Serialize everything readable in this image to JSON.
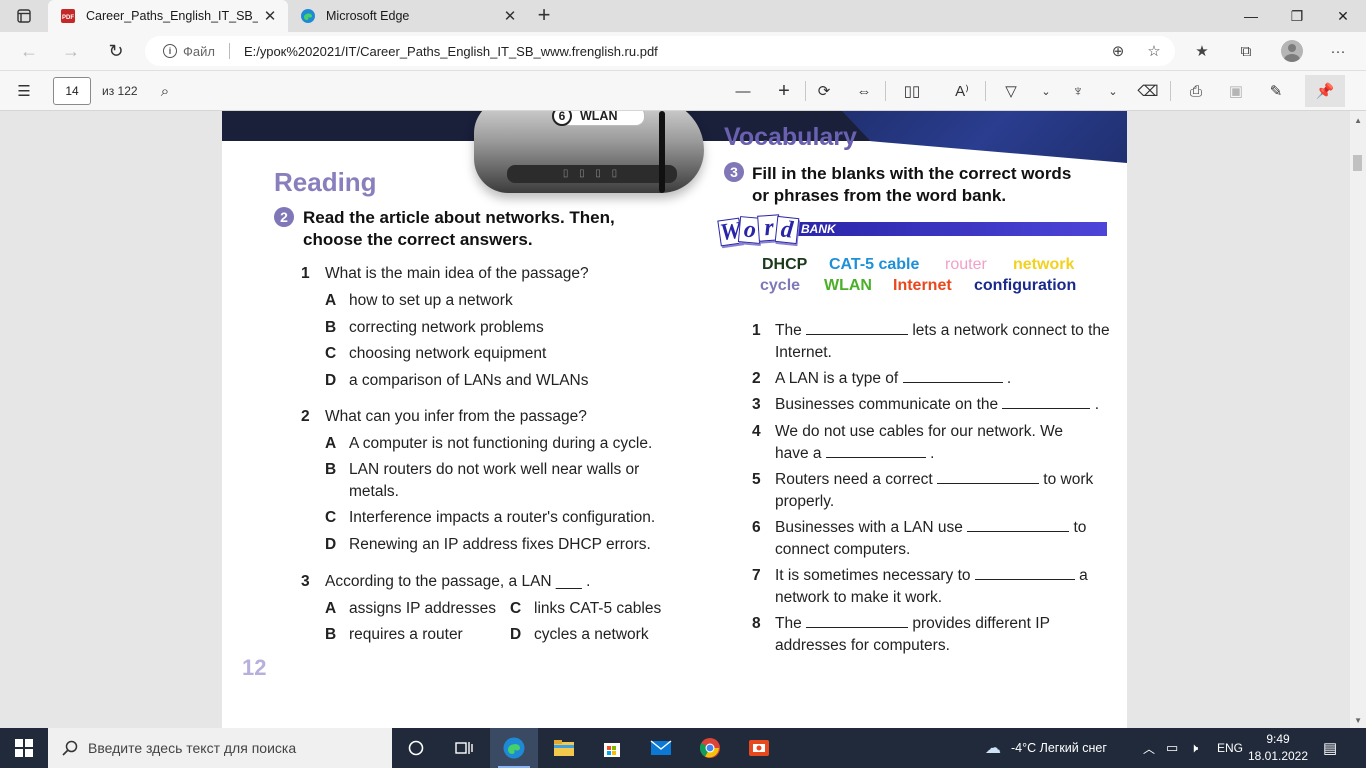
{
  "browser": {
    "tabs": [
      {
        "title": "Career_Paths_English_IT_SB_www.frenglish.ru.pdf",
        "active": true
      },
      {
        "title": "Microsoft Edge",
        "active": false
      }
    ],
    "address": {
      "scheme_label": "Файл",
      "url": "E:/урок%202021/IT/Career_Paths_English_IT_SB_www.frenglish.ru.pdf"
    }
  },
  "pdf_toolbar": {
    "page_input": "14",
    "page_count": "из 122"
  },
  "page": {
    "image_badge": {
      "number": "6",
      "label": "WLAN"
    },
    "reading": {
      "heading": "Reading",
      "exercise_number": "2",
      "instruction_line1": "Read the article about networks. Then,",
      "instruction_line2": "choose the correct answers.",
      "questions": [
        {
          "number": "1",
          "text": "What is the main idea of the passage?",
          "options": [
            {
              "letter": "A",
              "text": "how to set up a network"
            },
            {
              "letter": "B",
              "text": "correcting network problems"
            },
            {
              "letter": "C",
              "text": "choosing network equipment"
            },
            {
              "letter": "D",
              "text": "a comparison of LANs and WLANs"
            }
          ]
        },
        {
          "number": "2",
          "text": "What can you infer from the passage?",
          "options": [
            {
              "letter": "A",
              "text": "A computer is not functioning during a cycle."
            },
            {
              "letter": "B",
              "text": "LAN routers do not work well near walls or metals."
            },
            {
              "letter": "C",
              "text": "Interference impacts a router's configuration."
            },
            {
              "letter": "D",
              "text": "Renewing an IP address fixes DHCP errors."
            }
          ]
        },
        {
          "number": "3",
          "text": "According to the passage, a LAN ___ .",
          "options": [
            {
              "letter": "A",
              "text": "assigns IP addresses"
            },
            {
              "letter": "C",
              "text": "links CAT-5 cables"
            },
            {
              "letter": "B",
              "text": "requires a router"
            },
            {
              "letter": "D",
              "text": "cycles a network"
            }
          ]
        }
      ]
    },
    "vocabulary": {
      "heading": "Vocabulary",
      "exercise_number": "3",
      "instruction_line1": "Fill in the blanks with the correct words",
      "instruction_line2": "or phrases from the word bank.",
      "word_bank_letters": [
        "W",
        "o",
        "r",
        "d"
      ],
      "word_bank_label": "BANK",
      "words": [
        {
          "text": "DHCP",
          "color": "#1a3a1a"
        },
        {
          "text": "CAT-5 cable",
          "color": "#1e90d8"
        },
        {
          "text": "router",
          "color": "#f2a0c8"
        },
        {
          "text": "network",
          "color": "#f2d21e"
        },
        {
          "text": "cycle",
          "color": "#7f77b8"
        },
        {
          "text": "WLAN",
          "color": "#4caf28"
        },
        {
          "text": "Internet",
          "color": "#e8481e"
        },
        {
          "text": "configuration",
          "color": "#1a2a8c"
        }
      ],
      "sentences": [
        {
          "number": "1",
          "before": "The",
          "after": "lets a network connect to the Internet."
        },
        {
          "number": "2",
          "before": "A LAN is a type of",
          "after": "."
        },
        {
          "number": "3",
          "before": "Businesses communicate on the",
          "after": "."
        },
        {
          "number": "4",
          "before": "We do not use cables for our network. We have a",
          "after": "."
        },
        {
          "number": "5",
          "before": "Routers need a correct",
          "after": "to work properly."
        },
        {
          "number": "6",
          "before": "Businesses with a LAN use",
          "after": "to connect computers."
        },
        {
          "number": "7",
          "before": "It is sometimes necessary to",
          "after": "a network to make it work."
        },
        {
          "number": "8",
          "before": "The",
          "after": "provides different IP addresses for computers."
        }
      ]
    },
    "page_number": "12"
  },
  "taskbar": {
    "search_placeholder": "Введите здесь текст для поиска",
    "weather": "-4°C  Легкий снег",
    "language": "ENG",
    "time": "9:49",
    "date": "18.01.2022"
  },
  "colors": {
    "heading_purple": "#8a7fbd",
    "word_bank_blue": "#2a25a8",
    "taskbar_bg": "#202a3a"
  }
}
